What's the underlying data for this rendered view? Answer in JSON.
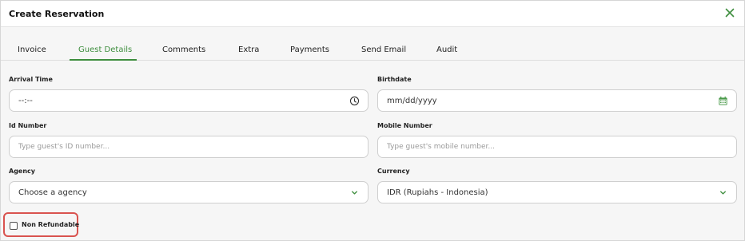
{
  "dialog": {
    "title": "Create Reservation",
    "close_icon": "close-x-icon"
  },
  "tabs": [
    {
      "label": "Invoice",
      "active": false
    },
    {
      "label": "Guest Details",
      "active": true
    },
    {
      "label": "Comments",
      "active": false
    },
    {
      "label": "Extra",
      "active": false
    },
    {
      "label": "Payments",
      "active": false
    },
    {
      "label": "Send Email",
      "active": false
    },
    {
      "label": "Audit",
      "active": false
    }
  ],
  "form": {
    "arrival_time": {
      "label": "Arrival Time",
      "value": "--:--",
      "icon": "clock-icon"
    },
    "birthdate": {
      "label": "Birthdate",
      "value": "mm/dd/yyyy",
      "icon": "calendar-icon"
    },
    "id_number": {
      "label": "Id Number",
      "placeholder": "Type guest's ID number..."
    },
    "mobile_number": {
      "label": "Mobile Number",
      "placeholder": "Type guest's mobile number..."
    },
    "agency": {
      "label": "Agency",
      "value": "Choose a agency",
      "icon": "chevron-down-icon"
    },
    "currency": {
      "label": "Currency",
      "value": "IDR (Rupiahs - Indonesia)",
      "icon": "chevron-down-icon"
    },
    "non_refundable": {
      "label": "Non Refundable",
      "checked": false
    }
  },
  "colors": {
    "accent": "#3e8e3e",
    "highlight": "#d9534f"
  }
}
